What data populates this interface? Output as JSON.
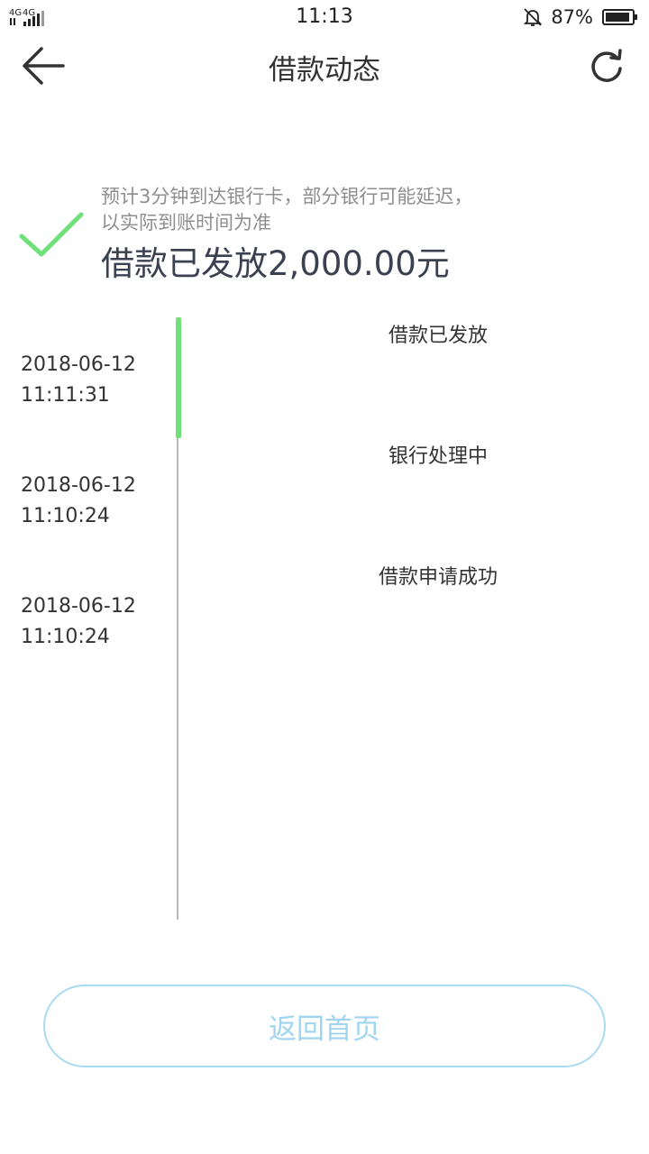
{
  "status_bar": {
    "network": "4G 4G",
    "time": "11:13",
    "battery_percent": "87%",
    "icons": [
      "signal-icon",
      "bell-off-icon",
      "battery-icon"
    ]
  },
  "nav": {
    "title": "借款动态",
    "back_icon": "arrow-left-icon",
    "refresh_icon": "refresh-icon"
  },
  "result": {
    "icon": "check-icon",
    "note": "预计3分钟到达银行卡，部分银行可能延迟，以实际到账时间为准",
    "amount_text": "借款已发放2,000.00元"
  },
  "timeline": [
    {
      "status": "借款已发放",
      "date": "2018-06-12",
      "time": "11:11:31",
      "active": true
    },
    {
      "status": "银行处理中",
      "date": "2018-06-12",
      "time": "11:10:24",
      "active": false
    },
    {
      "status": "借款申请成功",
      "date": "2018-06-12",
      "time": "11:10:24",
      "active": false
    }
  ],
  "footer": {
    "home_button_label": "返回首页"
  },
  "colors": {
    "accent_green": "#6fe07a",
    "button_blue": "#9fd5ee",
    "amount_text": "#3c4152"
  }
}
